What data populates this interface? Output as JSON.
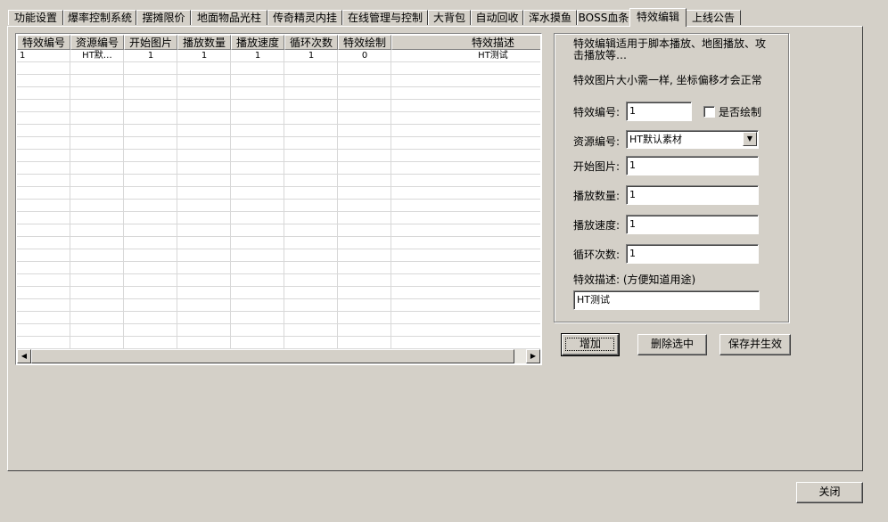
{
  "tabs": [
    {
      "label": "功能设置"
    },
    {
      "label": "爆率控制系统"
    },
    {
      "label": "摆摊限价"
    },
    {
      "label": "地面物品光柱"
    },
    {
      "label": "传奇精灵内挂"
    },
    {
      "label": "在线管理与控制"
    },
    {
      "label": "大背包"
    },
    {
      "label": "自动回收"
    },
    {
      "label": "浑水摸鱼"
    },
    {
      "label": "BOSS血条"
    },
    {
      "label": "特效编辑"
    },
    {
      "label": "上线公告"
    }
  ],
  "grid": {
    "columns": [
      "特效编号",
      "资源编号",
      "开始图片",
      "播放数量",
      "播放速度",
      "循环次数",
      "特效绘制",
      "特效描述"
    ],
    "rows": [
      [
        "1",
        "HT默…",
        "1",
        "1",
        "1",
        "1",
        "0",
        "HT测试"
      ]
    ]
  },
  "editor": {
    "note1": "特效编辑适用于脚本播放、地图播放、攻击播放等…",
    "note2": "特效图片大小需一样, 坐标偏移才会正常",
    "effect_id_label": "特效编号:",
    "effect_id_value": "1",
    "draw_checkbox_label": "是否绘制",
    "draw_checked": false,
    "resource_label": "资源编号:",
    "resource_value": "HT默认素材",
    "start_frame_label": "开始图片:",
    "start_frame_value": "1",
    "play_count_label": "播放数量:",
    "play_count_value": "1",
    "play_speed_label": "播放速度:",
    "play_speed_value": "1",
    "loop_count_label": "循环次数:",
    "loop_count_value": "1",
    "desc_label": "特效描述: (方便知道用途)",
    "desc_value": "HT测试"
  },
  "buttons": {
    "add": "增加",
    "delete": "删除选中",
    "save": "保存并生效",
    "close": "关闭"
  }
}
